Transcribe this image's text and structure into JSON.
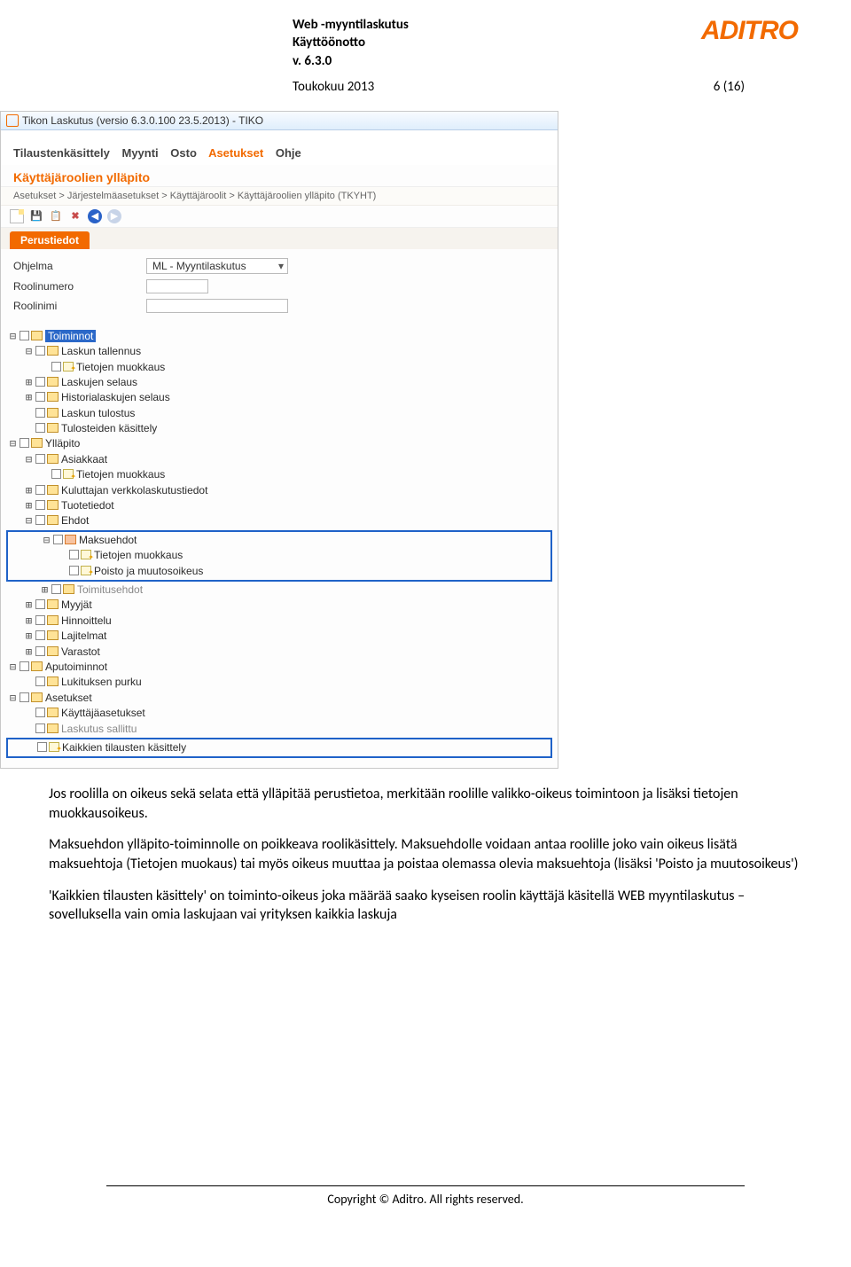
{
  "header": {
    "line1": "Web -myyntilaskutus",
    "line2": "Käyttöönotto",
    "line3": "v. 6.3.0",
    "logo_text": "ADITRO",
    "date": "Toukokuu 2013",
    "pagenum": "6 (16)"
  },
  "app": {
    "titlebar": "Tikon Laskutus (versio 6.3.0.100 23.5.2013) - TIKO",
    "menu": {
      "items": [
        "Tilaustenkäsittely",
        "Myynti",
        "Osto",
        "Asetukset",
        "Ohje"
      ],
      "active": "Asetukset"
    },
    "page_title": "Käyttäjäroolien ylläpito",
    "breadcrumb": "Asetukset > Järjestelmäasetukset > Käyttäjäroolit > Käyttäjäroolien ylläpito  (TKYHT)",
    "tab_label": "Perustiedot",
    "form": {
      "ohjelma_label": "Ohjelma",
      "ohjelma_value": "ML - Myyntilaskutus",
      "roolinumero_label": "Roolinumero",
      "roolinimi_label": "Roolinimi"
    },
    "tree": {
      "root": "Toiminnot",
      "n_laskun_tallennus": "Laskun tallennus",
      "n_tietojen_muokkaus": "Tietojen muokkaus",
      "n_laskujen_selaus": "Laskujen selaus",
      "n_historialaskujen_selaus": "Historialaskujen selaus",
      "n_laskun_tulostus": "Laskun tulostus",
      "n_tulosteiden_kasittely": "Tulosteiden käsittely",
      "n_yllapito": "Ylläpito",
      "n_asiakkaat": "Asiakkaat",
      "n_tietojen_muokkaus2": "Tietojen muokkaus",
      "n_kuluttajan_verkkolaskutustiedot": "Kuluttajan verkkolaskutustiedot",
      "n_tuotetiedot": "Tuotetiedot",
      "n_ehdot": "Ehdot",
      "n_maksuehdot": "Maksuehdot",
      "n_tietojen_muokkaus3": "Tietojen muokkaus",
      "n_poisto_ja_muutosoikeus": "Poisto ja muutosoikeus",
      "n_toimitusehdot": "Toimitusehdot",
      "n_myyjat": "Myyjät",
      "n_hinnoittelu": "Hinnoittelu",
      "n_lajitelmat": "Lajitelmat",
      "n_varastot": "Varastot",
      "n_aputoiminnot": "Aputoiminnot",
      "n_lukituksen_purku": "Lukituksen purku",
      "n_asetukset": "Asetukset",
      "n_kayttaja_asetukset": "Käyttäjäasetukset",
      "n_laskutus_sallittu": "Laskutus sallittu",
      "n_kaikkien_tilausten_kasittely": "Kaikkien tilausten käsittely"
    }
  },
  "paragraphs": {
    "p1": "Jos roolilla on oikeus sekä selata että ylläpitää perustietoa, merkitään roolille valikko-oikeus toimintoon ja lisäksi tietojen muokkausoikeus.",
    "p2": "Maksuehdon ylläpito-toiminnolle on poikkeava roolikäsittely. Maksuehdolle voidaan antaa roolille joko vain oikeus lisätä maksuehtoja (Tietojen muokaus) tai myös oikeus muuttaa ja poistaa olemassa olevia maksuehtoja (lisäksi 'Poisto ja muutosoikeus')",
    "p3": "'Kaikkien tilausten käsittely' on toiminto-oikeus joka määrää saako kyseisen roolin käyttäjä käsitellä WEB myyntilaskutus –sovelluksella vain omia laskujaan vai yrityksen kaikkia laskuja"
  },
  "footer": {
    "copyright": "Copyright © Aditro. All rights reserved."
  }
}
